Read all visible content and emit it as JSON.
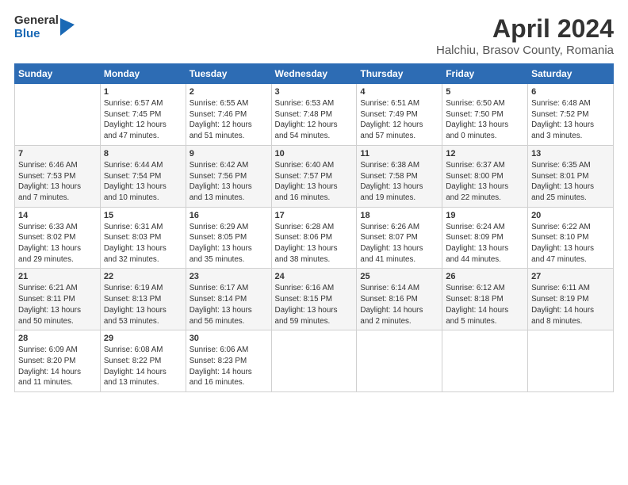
{
  "header": {
    "logo_line1": "General",
    "logo_line2": "Blue",
    "title": "April 2024",
    "subtitle": "Halchiu, Brasov County, Romania"
  },
  "days_of_week": [
    "Sunday",
    "Monday",
    "Tuesday",
    "Wednesday",
    "Thursday",
    "Friday",
    "Saturday"
  ],
  "weeks": [
    [
      {
        "day": "",
        "info": ""
      },
      {
        "day": "1",
        "info": "Sunrise: 6:57 AM\nSunset: 7:45 PM\nDaylight: 12 hours\nand 47 minutes."
      },
      {
        "day": "2",
        "info": "Sunrise: 6:55 AM\nSunset: 7:46 PM\nDaylight: 12 hours\nand 51 minutes."
      },
      {
        "day": "3",
        "info": "Sunrise: 6:53 AM\nSunset: 7:48 PM\nDaylight: 12 hours\nand 54 minutes."
      },
      {
        "day": "4",
        "info": "Sunrise: 6:51 AM\nSunset: 7:49 PM\nDaylight: 12 hours\nand 57 minutes."
      },
      {
        "day": "5",
        "info": "Sunrise: 6:50 AM\nSunset: 7:50 PM\nDaylight: 13 hours\nand 0 minutes."
      },
      {
        "day": "6",
        "info": "Sunrise: 6:48 AM\nSunset: 7:52 PM\nDaylight: 13 hours\nand 3 minutes."
      }
    ],
    [
      {
        "day": "7",
        "info": "Sunrise: 6:46 AM\nSunset: 7:53 PM\nDaylight: 13 hours\nand 7 minutes."
      },
      {
        "day": "8",
        "info": "Sunrise: 6:44 AM\nSunset: 7:54 PM\nDaylight: 13 hours\nand 10 minutes."
      },
      {
        "day": "9",
        "info": "Sunrise: 6:42 AM\nSunset: 7:56 PM\nDaylight: 13 hours\nand 13 minutes."
      },
      {
        "day": "10",
        "info": "Sunrise: 6:40 AM\nSunset: 7:57 PM\nDaylight: 13 hours\nand 16 minutes."
      },
      {
        "day": "11",
        "info": "Sunrise: 6:38 AM\nSunset: 7:58 PM\nDaylight: 13 hours\nand 19 minutes."
      },
      {
        "day": "12",
        "info": "Sunrise: 6:37 AM\nSunset: 8:00 PM\nDaylight: 13 hours\nand 22 minutes."
      },
      {
        "day": "13",
        "info": "Sunrise: 6:35 AM\nSunset: 8:01 PM\nDaylight: 13 hours\nand 25 minutes."
      }
    ],
    [
      {
        "day": "14",
        "info": "Sunrise: 6:33 AM\nSunset: 8:02 PM\nDaylight: 13 hours\nand 29 minutes."
      },
      {
        "day": "15",
        "info": "Sunrise: 6:31 AM\nSunset: 8:03 PM\nDaylight: 13 hours\nand 32 minutes."
      },
      {
        "day": "16",
        "info": "Sunrise: 6:29 AM\nSunset: 8:05 PM\nDaylight: 13 hours\nand 35 minutes."
      },
      {
        "day": "17",
        "info": "Sunrise: 6:28 AM\nSunset: 8:06 PM\nDaylight: 13 hours\nand 38 minutes."
      },
      {
        "day": "18",
        "info": "Sunrise: 6:26 AM\nSunset: 8:07 PM\nDaylight: 13 hours\nand 41 minutes."
      },
      {
        "day": "19",
        "info": "Sunrise: 6:24 AM\nSunset: 8:09 PM\nDaylight: 13 hours\nand 44 minutes."
      },
      {
        "day": "20",
        "info": "Sunrise: 6:22 AM\nSunset: 8:10 PM\nDaylight: 13 hours\nand 47 minutes."
      }
    ],
    [
      {
        "day": "21",
        "info": "Sunrise: 6:21 AM\nSunset: 8:11 PM\nDaylight: 13 hours\nand 50 minutes."
      },
      {
        "day": "22",
        "info": "Sunrise: 6:19 AM\nSunset: 8:13 PM\nDaylight: 13 hours\nand 53 minutes."
      },
      {
        "day": "23",
        "info": "Sunrise: 6:17 AM\nSunset: 8:14 PM\nDaylight: 13 hours\nand 56 minutes."
      },
      {
        "day": "24",
        "info": "Sunrise: 6:16 AM\nSunset: 8:15 PM\nDaylight: 13 hours\nand 59 minutes."
      },
      {
        "day": "25",
        "info": "Sunrise: 6:14 AM\nSunset: 8:16 PM\nDaylight: 14 hours\nand 2 minutes."
      },
      {
        "day": "26",
        "info": "Sunrise: 6:12 AM\nSunset: 8:18 PM\nDaylight: 14 hours\nand 5 minutes."
      },
      {
        "day": "27",
        "info": "Sunrise: 6:11 AM\nSunset: 8:19 PM\nDaylight: 14 hours\nand 8 minutes."
      }
    ],
    [
      {
        "day": "28",
        "info": "Sunrise: 6:09 AM\nSunset: 8:20 PM\nDaylight: 14 hours\nand 11 minutes."
      },
      {
        "day": "29",
        "info": "Sunrise: 6:08 AM\nSunset: 8:22 PM\nDaylight: 14 hours\nand 13 minutes."
      },
      {
        "day": "30",
        "info": "Sunrise: 6:06 AM\nSunset: 8:23 PM\nDaylight: 14 hours\nand 16 minutes."
      },
      {
        "day": "",
        "info": ""
      },
      {
        "day": "",
        "info": ""
      },
      {
        "day": "",
        "info": ""
      },
      {
        "day": "",
        "info": ""
      }
    ]
  ]
}
